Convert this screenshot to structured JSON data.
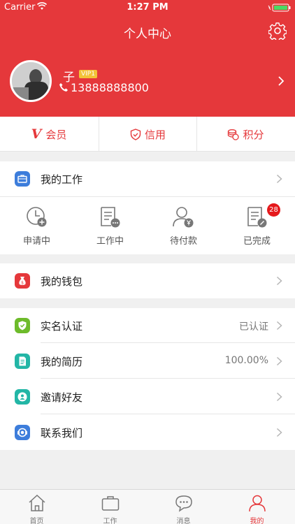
{
  "status_bar": {
    "carrier": "Carrier",
    "time": "1:27 PM"
  },
  "header": {
    "title": "个人中心"
  },
  "profile": {
    "name": "子",
    "vip": "VIP1",
    "phone": "13888888800"
  },
  "tabs": [
    {
      "label": "会员",
      "icon": "v-icon"
    },
    {
      "label": "信用",
      "icon": "shield-icon"
    },
    {
      "label": "积分",
      "icon": "coins-icon"
    }
  ],
  "my_work": {
    "label": "我的工作",
    "items": [
      {
        "label": "申请中",
        "icon": "clock-add-icon"
      },
      {
        "label": "工作中",
        "icon": "document-more-icon"
      },
      {
        "label": "待付款",
        "icon": "user-yen-icon"
      },
      {
        "label": "已完成",
        "icon": "document-edit-icon",
        "badge": "28"
      }
    ]
  },
  "wallet": {
    "label": "我的钱包"
  },
  "menu": [
    {
      "label": "实名认证",
      "value": "已认证",
      "icon": "verified-icon",
      "color": "#6dbb2a"
    },
    {
      "label": "我的简历",
      "value": "100.00%",
      "icon": "resume-icon",
      "color": "#23b6a6"
    },
    {
      "label": "邀请好友",
      "value": "",
      "icon": "invite-icon",
      "color": "#23b6a6"
    },
    {
      "label": "联系我们",
      "value": "",
      "icon": "contact-icon",
      "color": "#3d7ddb"
    }
  ],
  "tabbar": [
    {
      "label": "首页",
      "icon": "home-icon"
    },
    {
      "label": "工作",
      "icon": "briefcase-icon"
    },
    {
      "label": "消息",
      "icon": "message-icon"
    },
    {
      "label": "我的",
      "icon": "person-icon",
      "active": true
    }
  ],
  "colors": {
    "brand": "#e5383b",
    "badge": "#e5191c"
  }
}
